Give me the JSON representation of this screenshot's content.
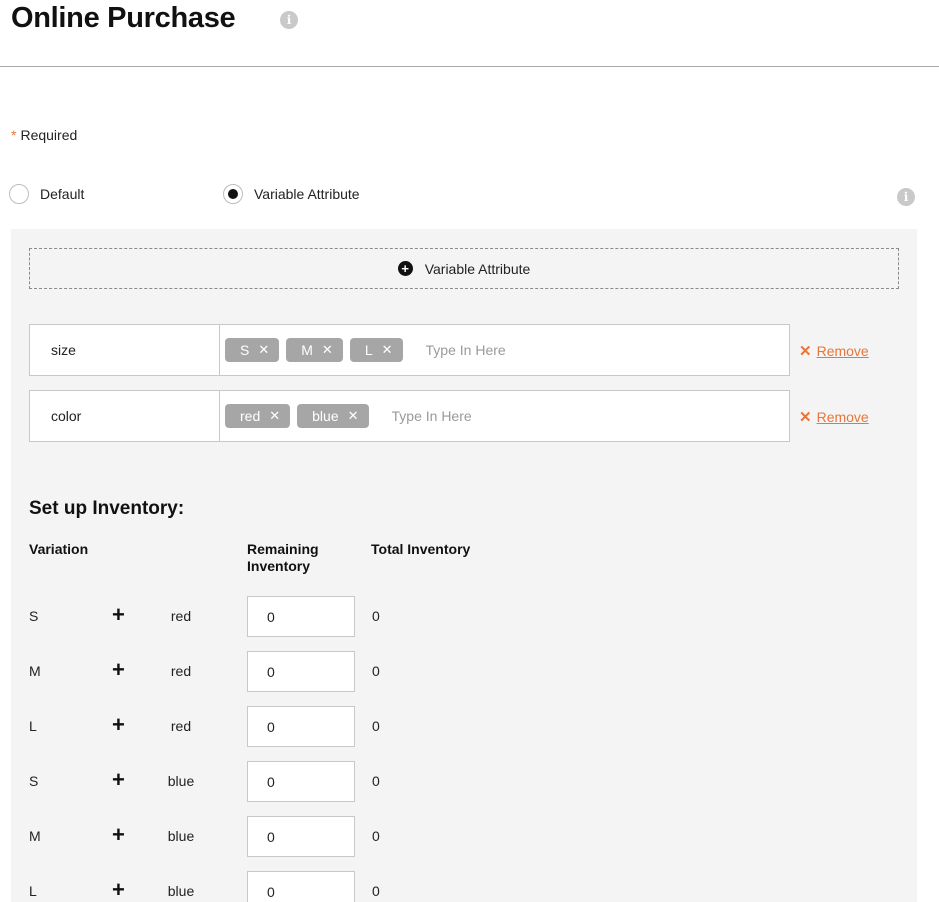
{
  "page": {
    "title": "Online Purchase"
  },
  "form": {
    "required_star": "*",
    "required_label": "Required"
  },
  "mode": {
    "options": [
      {
        "label": "Default",
        "selected": false
      },
      {
        "label": "Variable Attribute",
        "selected": true
      }
    ]
  },
  "attributes": {
    "add_label": "Variable Attribute",
    "placeholder": "Type In Here",
    "remove_label": "Remove",
    "items": [
      {
        "name": "size",
        "values": [
          "S",
          "M",
          "L"
        ]
      },
      {
        "name": "color",
        "values": [
          "red",
          "blue"
        ]
      }
    ]
  },
  "inventory": {
    "title": "Set up Inventory:",
    "headers": {
      "variation": "Variation",
      "remaining": "Remaining Inventory",
      "total": "Total Inventory"
    },
    "rows": [
      {
        "size": "S",
        "color": "red",
        "remaining": "0",
        "total": "0"
      },
      {
        "size": "M",
        "color": "red",
        "remaining": "0",
        "total": "0"
      },
      {
        "size": "L",
        "color": "red",
        "remaining": "0",
        "total": "0"
      },
      {
        "size": "S",
        "color": "blue",
        "remaining": "0",
        "total": "0"
      },
      {
        "size": "M",
        "color": "blue",
        "remaining": "0",
        "total": "0"
      },
      {
        "size": "L",
        "color": "blue",
        "remaining": "0",
        "total": "0"
      }
    ]
  },
  "icons": {
    "info": "info-icon",
    "add": "plus-circle-icon",
    "remove": "close-icon",
    "tag_remove": "close-icon",
    "combine": "plus-icon"
  },
  "colors": {
    "accent": "#e8763a",
    "tag": "#a6a6a6",
    "panel": "#f4f4f4"
  }
}
